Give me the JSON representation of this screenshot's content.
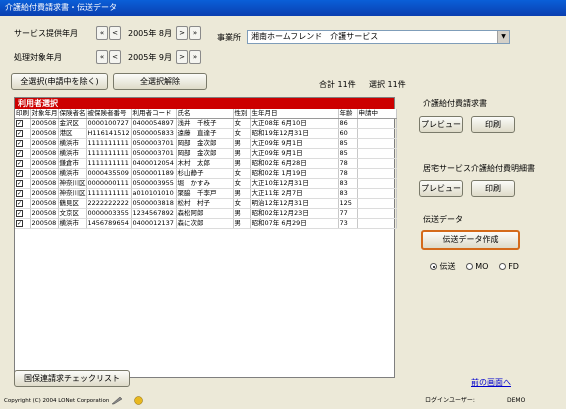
{
  "window": {
    "title": "介護給付費請求書・伝送データ"
  },
  "service_month": {
    "label": "サービス提供年月",
    "value": "2005年 8月"
  },
  "process_month": {
    "label": "処理対象年月",
    "value": "2005年 9月"
  },
  "nav": {
    "first": "«",
    "prev": "<",
    "next": ">",
    "last": "»"
  },
  "office": {
    "label": "事業所",
    "value": "湘南ホームフレンド　介護サービス"
  },
  "buttons": {
    "select_all": "全選択(申請中を除く)",
    "deselect_all": "全選択解除",
    "national_check": "国保連請求チェックリスト"
  },
  "summary": {
    "total": "合計 11件",
    "selected": "選択 11件"
  },
  "grid": {
    "title": "利用者選択",
    "columns": [
      "印刷",
      "対象年月",
      "保険者名",
      "被保険者番号",
      "利用者コード",
      "氏名",
      "性別",
      "生年月日",
      "年齢",
      "申請中"
    ],
    "rows": [
      {
        "print": "✓",
        "month": "200508",
        "insurer": "金沢区",
        "insured_no": "0000100727",
        "user_code": "0400054897",
        "name": "浅井　千枝子",
        "sex": "女",
        "dob": "大正08年 6月10日",
        "age": "86",
        "pending": ""
      },
      {
        "print": "✓",
        "month": "200508",
        "insurer": "港区",
        "insured_no": "H116141512",
        "user_code": "0500005833",
        "name": "遠藤　直達子",
        "sex": "女",
        "dob": "昭和19年12月31日",
        "age": "60",
        "pending": ""
      },
      {
        "print": "✓",
        "month": "200508",
        "insurer": "横浜市",
        "insured_no": "1111111111",
        "user_code": "0500003701",
        "name": "岡部　金次郎",
        "sex": "男",
        "dob": "大正09年 9月1日",
        "age": "85",
        "pending": ""
      },
      {
        "print": "✓",
        "month": "200508",
        "insurer": "横浜市",
        "insured_no": "1111111111",
        "user_code": "0500003701",
        "name": "岡部　金次郎",
        "sex": "男",
        "dob": "大正09年 9月1日",
        "age": "85",
        "pending": ""
      },
      {
        "print": "✓",
        "month": "200508",
        "insurer": "鎌倉市",
        "insured_no": "1111111111",
        "user_code": "0400012054",
        "name": "木村　太郎",
        "sex": "男",
        "dob": "昭和02年 6月28日",
        "age": "78",
        "pending": ""
      },
      {
        "print": "✓",
        "month": "200508",
        "insurer": "横浜市",
        "insured_no": "0000435509",
        "user_code": "0500001189",
        "name": "杉山静子",
        "sex": "女",
        "dob": "昭和02年 1月19日",
        "age": "78",
        "pending": ""
      },
      {
        "print": "✓",
        "month": "200508",
        "insurer": "神奈川区",
        "insured_no": "0000000111",
        "user_code": "0500003955",
        "name": "堀　かすみ",
        "sex": "女",
        "dob": "大正10年12月31日",
        "age": "83",
        "pending": ""
      },
      {
        "print": "✓",
        "month": "200508",
        "insurer": "神奈川区",
        "insured_no": "1111111111",
        "user_code": "a010101010",
        "name": "聚脇　千李戸",
        "sex": "男",
        "dob": "大正11年 2月7日",
        "age": "83",
        "pending": ""
      },
      {
        "print": "✓",
        "month": "200508",
        "insurer": "鶴見区",
        "insured_no": "2222222222",
        "user_code": "0500003818",
        "name": "松村　村子",
        "sex": "女",
        "dob": "明治12年12月31日",
        "age": "125",
        "pending": ""
      },
      {
        "print": "✓",
        "month": "200508",
        "insurer": "文京区",
        "insured_no": "0000003355",
        "user_code": "1234567892",
        "name": "森松阿郎",
        "sex": "男",
        "dob": "昭和02年12月23日",
        "age": "77",
        "pending": ""
      },
      {
        "print": "✓",
        "month": "200508",
        "insurer": "横浜市",
        "insured_no": "1456789654",
        "user_code": "0400012137",
        "name": "森に次郎",
        "sex": "男",
        "dob": "昭和07年 6月29日",
        "age": "73",
        "pending": ""
      }
    ]
  },
  "kaigo_claim": {
    "title": "介護給付費請求書",
    "preview": "プレビュー",
    "print": "印刷"
  },
  "home_claim": {
    "title": "居宅サービス介護給付費明細書",
    "preview": "プレビュー",
    "print": "印刷"
  },
  "transmission": {
    "title": "伝送データ",
    "create": "伝送データ作成",
    "options": [
      {
        "label": "伝送",
        "selected": true
      },
      {
        "label": "MO",
        "selected": false
      },
      {
        "label": "FD",
        "selected": false
      }
    ]
  },
  "links": {
    "back": "前の画面へ"
  },
  "status": {
    "copyright": "Copyright (C) 2004 LONet Corporation",
    "login_label": "ログインユーザー:",
    "login_user": "DEMO"
  },
  "colors": {
    "grid_title": "#cc0000",
    "titlebar": "#0a5fd8",
    "link": "#0000cc"
  }
}
